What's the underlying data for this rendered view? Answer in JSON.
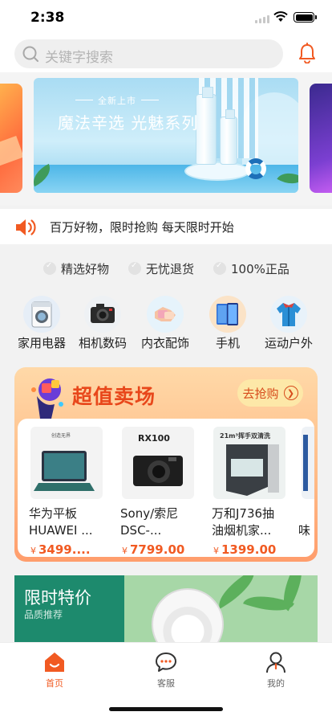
{
  "status_bar": {
    "time": "2:38"
  },
  "search": {
    "placeholder": "关键字搜索"
  },
  "banner": {
    "pill": "全新上市",
    "title": "魔法辛选 光魅系列"
  },
  "notice": {
    "text": "百万好物，限时抢购 每天限时开始"
  },
  "features": [
    {
      "label": "精选好物"
    },
    {
      "label": "无忧退货"
    },
    {
      "label": "100%正品"
    }
  ],
  "categories": [
    {
      "label": "家用电器",
      "icon": "washing-machine-icon"
    },
    {
      "label": "相机数码",
      "icon": "camera-icon"
    },
    {
      "label": "内衣配饰",
      "icon": "underwear-icon"
    },
    {
      "label": "手机",
      "icon": "phone-icon"
    },
    {
      "label": "运动户外",
      "icon": "jacket-icon"
    }
  ],
  "deal": {
    "title": "超值卖场",
    "button_label": "去抢购",
    "products": [
      {
        "name": "华为平板\nHUAWEI ...",
        "currency": "¥",
        "price": "3499....",
        "img_text": "创造无界"
      },
      {
        "name": "Sony/索尼\nDSC-...",
        "currency": "¥",
        "price": "7799.00",
        "img_text": "RX100"
      },
      {
        "name": "万和J736抽\n油烟机家...",
        "currency": "¥",
        "price": "1399.00",
        "img_text": "21m³挥手双清洗"
      },
      {
        "name": "\n味",
        "currency": "",
        "price": "",
        "img_text": ""
      }
    ]
  },
  "flash_sale": {
    "title": "限时特价",
    "subtitle": "品质推荐"
  },
  "tabs": [
    {
      "label": "首页",
      "icon": "home-icon",
      "active": true
    },
    {
      "label": "客服",
      "icon": "chat-icon",
      "active": false
    },
    {
      "label": "我的",
      "icon": "user-icon",
      "active": false
    }
  ],
  "colors": {
    "accent": "#f15a22",
    "deal_title": "#e8471b",
    "flash_green": "#1d8a6d"
  }
}
